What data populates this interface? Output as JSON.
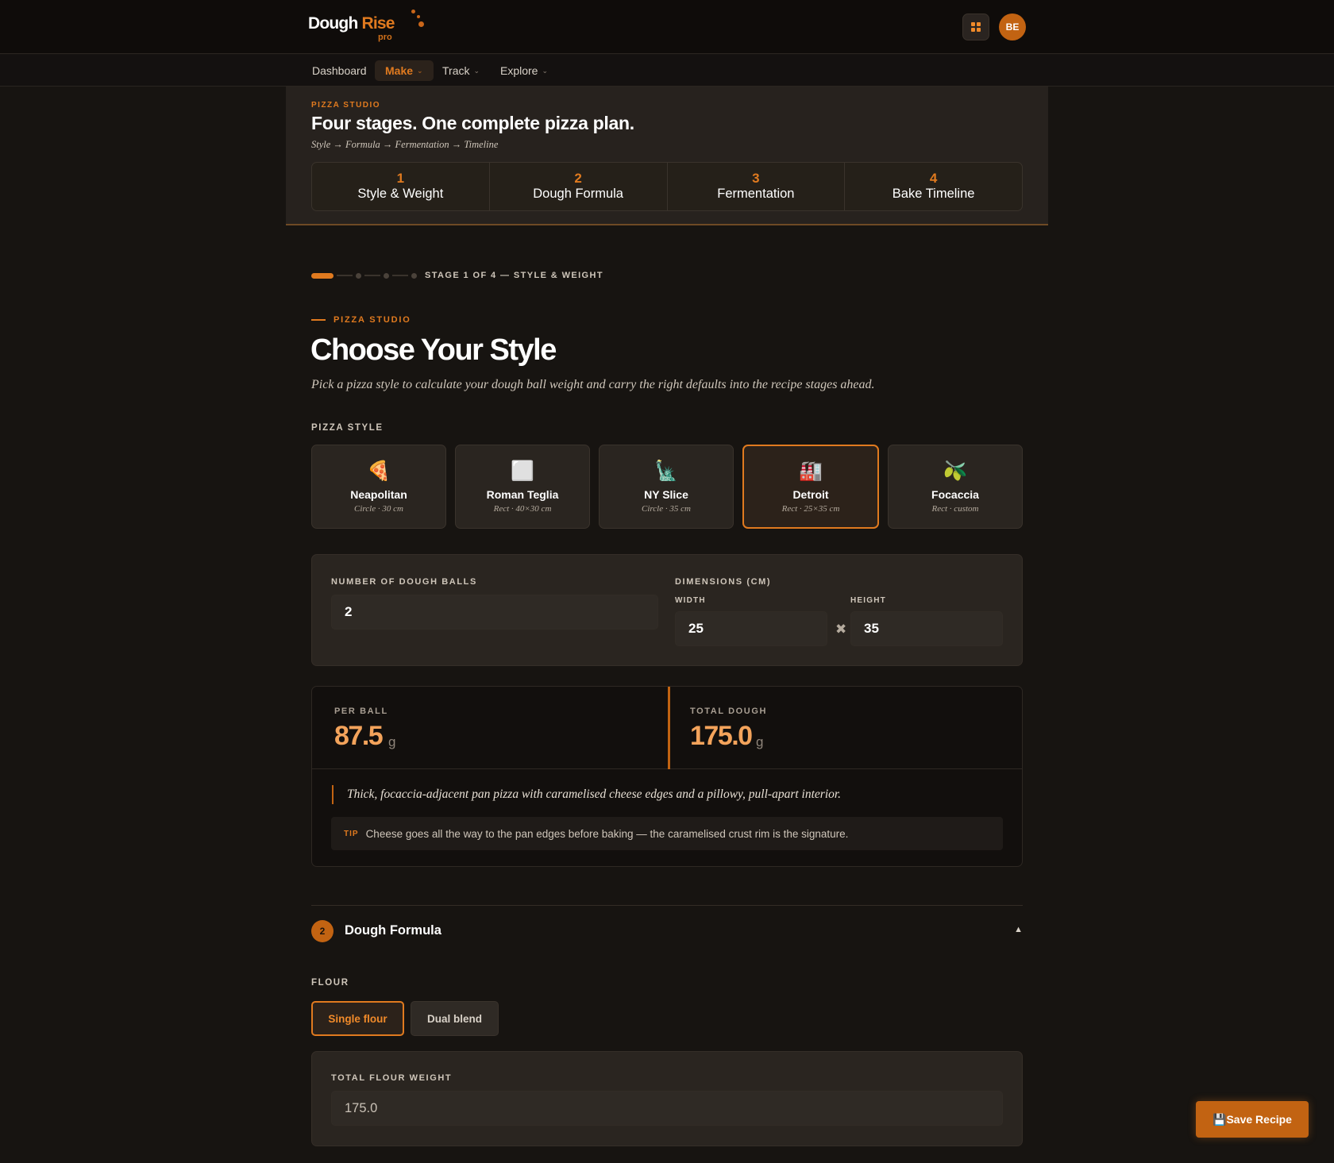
{
  "brand": {
    "word1": "Dough",
    "word2": "Rise",
    "tier": "pro"
  },
  "header": {
    "apps_icon": "grid-icon",
    "avatar_initials": "BE"
  },
  "nav": {
    "items": [
      {
        "label": "Dashboard",
        "caret": ""
      },
      {
        "label": "Make",
        "caret": "⌄"
      },
      {
        "label": "Track",
        "caret": "⌄"
      },
      {
        "label": "Explore",
        "caret": "⌄"
      }
    ],
    "active": "Make"
  },
  "studio": {
    "kicker": "PIZZA STUDIO",
    "headline": "Four stages. One complete pizza plan.",
    "flow": "Style → Formula → Fermentation → Timeline",
    "stages": [
      {
        "num": "1",
        "label": "Style & Weight"
      },
      {
        "num": "2",
        "label": "Dough Formula"
      },
      {
        "num": "3",
        "label": "Fermentation"
      },
      {
        "num": "4",
        "label": "Bake Timeline"
      }
    ]
  },
  "progress": {
    "label": "STAGE 1 OF 4 — STYLE & WEIGHT",
    "current": 1,
    "total": 4
  },
  "section1": {
    "kicker": "PIZZA STUDIO",
    "title": "Choose Your Style",
    "lead": "Pick a pizza style to calculate your dough ball weight and carry the right defaults into the recipe stages ahead.",
    "style_label": "PIZZA STYLE",
    "styles": [
      {
        "icon": "🍕",
        "icon_name": "pizza-slice-icon",
        "name": "Neapolitan",
        "sub": "Circle · 30 cm"
      },
      {
        "icon": "⬜",
        "icon_name": "square-icon",
        "name": "Roman Teglia",
        "sub": "Rect · 40×30 cm"
      },
      {
        "icon": "🗽",
        "icon_name": "statue-of-liberty-icon",
        "name": "NY Slice",
        "sub": "Circle · 35 cm"
      },
      {
        "icon": "🏭",
        "icon_name": "factory-icon",
        "name": "Detroit",
        "sub": "Rect · 25×35 cm"
      },
      {
        "icon": "🫒",
        "icon_name": "olive-icon",
        "name": "Focaccia",
        "sub": "Rect · custom"
      }
    ],
    "selected_style": "Detroit",
    "balls_label": "NUMBER OF DOUGH BALLS",
    "balls_value": "2",
    "dims_label": "DIMENSIONS (CM)",
    "width_label": "WIDTH",
    "width_value": "25",
    "height_label": "HEIGHT",
    "height_value": "35",
    "times_glyph": "✖"
  },
  "results": {
    "per_ball_label": "PER BALL",
    "per_ball_value": "87.5",
    "total_label": "TOTAL DOUGH",
    "total_value": "175.0",
    "unit": "g",
    "description": "Thick, focaccia-adjacent pan pizza with caramelised cheese edges and a pillowy, pull-apart interior.",
    "tip_label": "TIP",
    "tip_text": "Cheese goes all the way to the pan edges before baking — the caramelised crust rim is the signature."
  },
  "section2": {
    "num": "2",
    "title": "Dough Formula",
    "toggle": "▲",
    "flour_label": "FLOUR",
    "flour_options": [
      "Single flour",
      "Dual blend"
    ],
    "flour_selected": "Single flour",
    "total_flour_label": "TOTAL FLOUR WEIGHT",
    "total_flour_value": "175.0"
  },
  "save_button": {
    "icon": "💾",
    "label": "Save Recipe"
  },
  "colors": {
    "accent": "#e07a1f",
    "background": "#171411",
    "panel": "#2a2520",
    "result_value": "#f3a35b"
  }
}
